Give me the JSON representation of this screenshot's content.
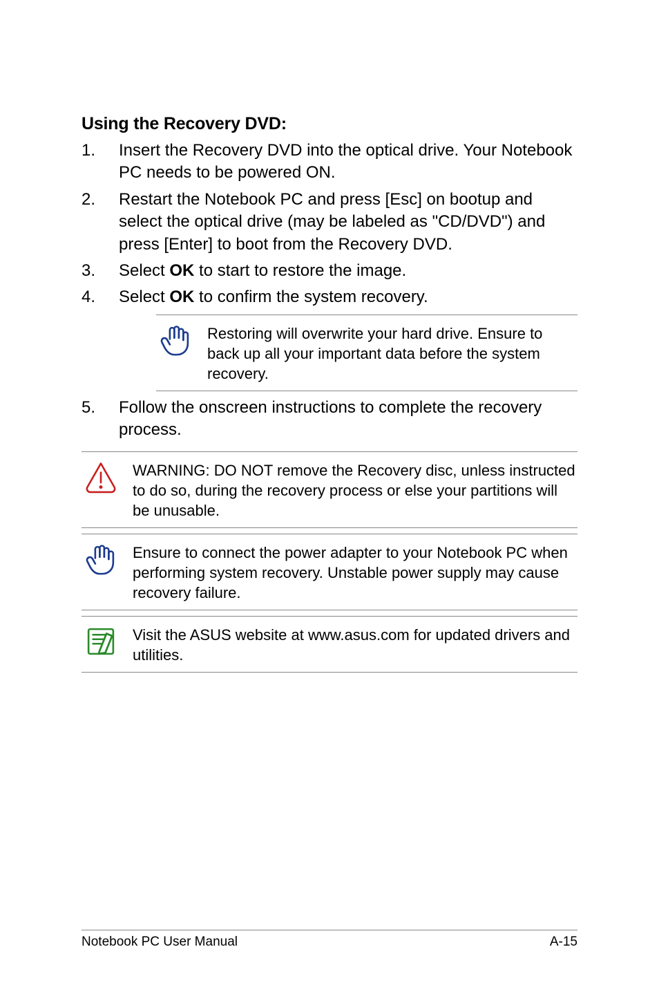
{
  "heading": "Using the Recovery DVD:",
  "steps": {
    "s1": "Insert the Recovery DVD into the optical drive. Your Notebook PC needs to be powered ON.",
    "s2": "Restart the Notebook PC and press [Esc] on bootup and select the optical drive (may be labeled as \"CD/DVD\") and press [Enter] to boot from the Recovery DVD.",
    "s3_pre": "Select ",
    "s3_bold": "OK",
    "s3_post": " to start to restore the image.",
    "s4_pre": "Select ",
    "s4_bold": "OK",
    "s4_post": " to confirm the system recovery.",
    "s5": "Follow the onscreen instructions to complete the recovery process."
  },
  "callouts": {
    "c1": "Restoring will overwrite your hard drive. Ensure to back up all your important data before the system recovery.",
    "c2": "WARNING: DO NOT remove the Recovery disc, unless instructed to do so, during the recovery process or else your partitions will be unusable.",
    "c3": "Ensure to connect the power adapter to your Notebook PC when performing system recovery. Unstable power supply may cause recovery failure.",
    "c4": "Visit the ASUS website at www.asus.com for updated drivers and utilities."
  },
  "footer": {
    "left": "Notebook PC User Manual",
    "right": "A-15"
  }
}
